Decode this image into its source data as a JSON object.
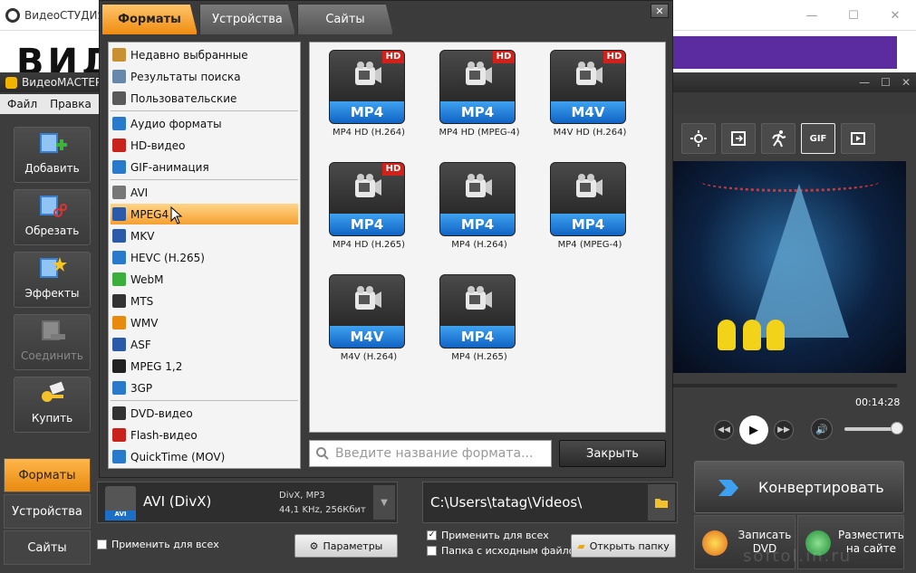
{
  "studio": {
    "title": "ВидеоСТУДИЯ",
    "big_text": "ВИД"
  },
  "videomaster": {
    "title": "ВидеоМАСТЕР",
    "menu": [
      "Файл",
      "Правка"
    ],
    "side_buttons": [
      {
        "label": "Добавить",
        "icon": "add-video-icon",
        "enabled": true
      },
      {
        "label": "Обрезать",
        "icon": "cut-icon",
        "enabled": true
      },
      {
        "label": "Эффекты",
        "icon": "effects-icon",
        "enabled": true
      },
      {
        "label": "Соединить",
        "icon": "join-icon",
        "enabled": false
      },
      {
        "label": "Купить",
        "icon": "buy-key-icon",
        "enabled": true
      }
    ],
    "bottom_tabs": [
      "Форматы",
      "Устройства",
      "Сайты"
    ],
    "active_bottom_tab": 0,
    "toolbar": {
      "gif_label": "GIF"
    },
    "timecode": "00:14:28",
    "format": {
      "name": "AVI (DivX)",
      "tag": "AVI",
      "info_line1": "DivX, MP3",
      "info_line2": "44,1 KHz, 256Кбит"
    },
    "apply_all_left": "Применить для всех",
    "params_button": "Параметры",
    "output_path": "C:\\Users\\tatag\\Videos\\",
    "apply_all_right": "Применить для всех",
    "source_folder": "Папка с исходным файлом",
    "open_folder_button": "Открыть папку",
    "convert_button": "Конвертировать",
    "burn_dvd_button": "Записать DVD",
    "publish_button": "Разместить на сайте",
    "watermark": "softol.in.ru"
  },
  "dialog": {
    "tabs": [
      "Форматы",
      "Устройства",
      "Сайты"
    ],
    "active_tab": 0,
    "categories": [
      {
        "label": "Недавно выбранные",
        "icon": "recent-icon",
        "color": "#c89030"
      },
      {
        "label": "Результаты поиска",
        "icon": "search-results-icon",
        "color": "#6688aa"
      },
      {
        "label": "Пользовательские",
        "icon": "user-profile-icon",
        "color": "#5a5a5a"
      },
      {
        "label": "Аудио форматы",
        "icon": "music-note-icon",
        "color": "#2a7acb"
      },
      {
        "label": "HD-видео",
        "icon": "hd-icon",
        "color": "#c8221a"
      },
      {
        "label": "GIF-анимация",
        "icon": "gif-icon",
        "color": "#2a7acb"
      },
      {
        "label": "AVI",
        "icon": "film-reel-icon",
        "color": "#777777"
      },
      {
        "label": "MPEG4",
        "icon": "mp4-icon",
        "color": "#2a5aa8"
      },
      {
        "label": "MKV",
        "icon": "mkv-icon",
        "color": "#2a5aa8"
      },
      {
        "label": "HEVC (H.265)",
        "icon": "hevc-icon",
        "color": "#2a7acb"
      },
      {
        "label": "WebM",
        "icon": "webm-play-icon",
        "color": "#3cae3c"
      },
      {
        "label": "MTS",
        "icon": "mts-icon",
        "color": "#333333"
      },
      {
        "label": "WMV",
        "icon": "wmv-icon",
        "color": "#e88a10"
      },
      {
        "label": "ASF",
        "icon": "asf-icon",
        "color": "#2a5aa8"
      },
      {
        "label": "MPEG 1,2",
        "icon": "mpeg-icon",
        "color": "#222222"
      },
      {
        "label": "3GP",
        "icon": "phone-icon",
        "color": "#2a7acb"
      },
      {
        "label": "DVD-видео",
        "icon": "dvd-icon",
        "color": "#333333"
      },
      {
        "label": "Flash-видео",
        "icon": "flash-icon",
        "color": "#c8221a"
      },
      {
        "label": "QuickTime (MOV)",
        "icon": "quicktime-icon",
        "color": "#2a7acb"
      }
    ],
    "selected_category": 7,
    "formats": [
      {
        "label": "MP4",
        "caption": "MP4 HD (H.264)",
        "hd": true
      },
      {
        "label": "MP4",
        "caption": "MP4 HD (MPEG-4)",
        "hd": true
      },
      {
        "label": "M4V",
        "caption": "M4V HD (H.264)",
        "hd": true
      },
      {
        "label": "MP4",
        "caption": "MP4 HD (H.265)",
        "hd": true
      },
      {
        "label": "MP4",
        "caption": "MP4 (H.264)",
        "hd": false
      },
      {
        "label": "MP4",
        "caption": "MP4 (MPEG-4)",
        "hd": false
      },
      {
        "label": "M4V",
        "caption": "M4V (H.264)",
        "hd": false
      },
      {
        "label": "MP4",
        "caption": "MP4 (H.265)",
        "hd": false
      }
    ],
    "hd_badge": "HD",
    "search_placeholder": "Введите название формата...",
    "close_button": "Закрыть"
  }
}
